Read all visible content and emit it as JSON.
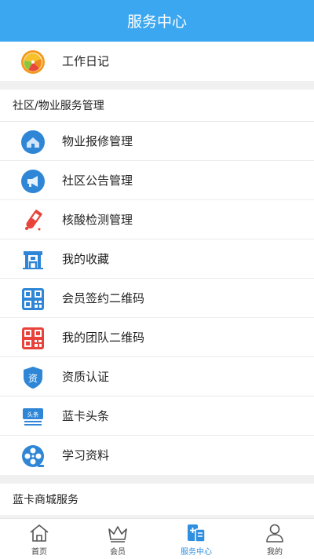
{
  "header": {
    "title": "服务中心"
  },
  "top_item": {
    "label": "工作日记",
    "icon": "fruit-icon"
  },
  "community_section": {
    "title": "社区/物业服务管理",
    "items": [
      {
        "label": "物业报修管理",
        "icon": "house-repair-icon"
      },
      {
        "label": "社区公告管理",
        "icon": "megaphone-icon"
      },
      {
        "label": "核酸检测管理",
        "icon": "test-tube-icon"
      },
      {
        "label": "我的收藏",
        "icon": "building-icon"
      },
      {
        "label": "会员签约二维码",
        "icon": "qr-code-icon"
      },
      {
        "label": "我的团队二维码",
        "icon": "qr-code-icon"
      },
      {
        "label": "资质认证",
        "icon": "certificate-shield-icon"
      },
      {
        "label": "蓝卡头条",
        "icon": "headline-icon"
      },
      {
        "label": "学习资料",
        "icon": "film-reel-icon"
      }
    ]
  },
  "mall_section": {
    "title": "蓝卡商城服务"
  },
  "tabbar": {
    "tabs": [
      {
        "label": "首页",
        "icon": "home-icon"
      },
      {
        "label": "会员",
        "icon": "crown-icon"
      },
      {
        "label": "服务中心",
        "icon": "service-center-icon"
      },
      {
        "label": "我的",
        "icon": "user-icon"
      }
    ],
    "active_index": 2
  },
  "colors": {
    "accent": "#3ba7f0",
    "active_tab": "#2e8fe0"
  }
}
